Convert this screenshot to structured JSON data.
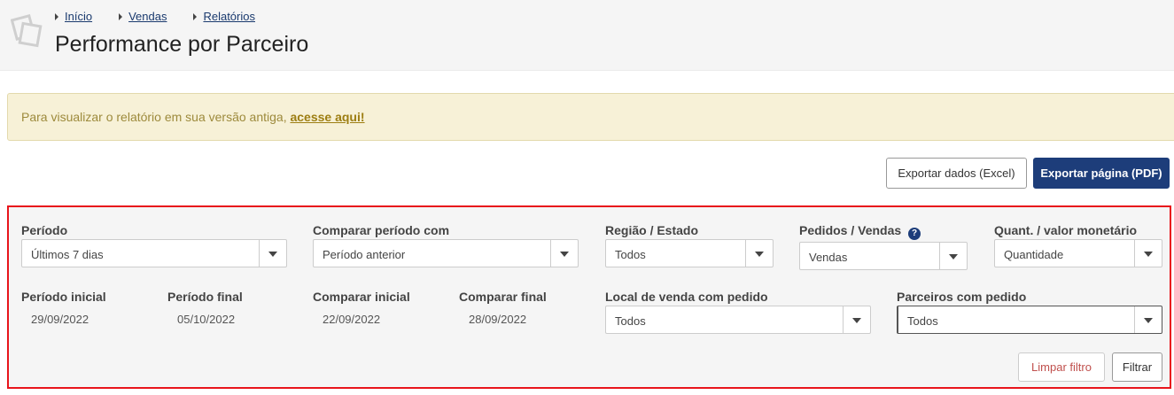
{
  "header": {
    "breadcrumb": [
      {
        "label": "Início"
      },
      {
        "label": "Vendas"
      },
      {
        "label": "Relatórios"
      }
    ],
    "title": "Performance por Parceiro"
  },
  "notice": {
    "text": "Para visualizar o relatório em sua versão antiga,",
    "link": "acesse aqui!"
  },
  "actions": {
    "export_excel": "Exportar dados (Excel)",
    "export_pdf": "Exportar página (PDF)"
  },
  "filters": {
    "periodo": {
      "label": "Período",
      "value": "Últimos 7 dias"
    },
    "comparar": {
      "label": "Comparar período com",
      "value": "Período anterior"
    },
    "regiao": {
      "label": "Região / Estado",
      "value": "Todos"
    },
    "pedidos": {
      "label": "Pedidos / Vendas",
      "value": "Vendas",
      "help": "?"
    },
    "quant": {
      "label": "Quant. / valor monetário",
      "value": "Quantidade"
    },
    "periodo_inicial": {
      "label": "Período inicial",
      "value": "29/09/2022"
    },
    "periodo_final": {
      "label": "Período final",
      "value": "05/10/2022"
    },
    "comparar_inicial": {
      "label": "Comparar inicial",
      "value": "22/09/2022"
    },
    "comparar_final": {
      "label": "Comparar final",
      "value": "28/09/2022"
    },
    "local_venda": {
      "label": "Local de venda com pedido",
      "value": "Todos"
    },
    "parceiros": {
      "label": "Parceiros com pedido",
      "value": "Todos"
    },
    "clear_button": "Limpar filtro",
    "filter_button": "Filtrar"
  },
  "colors": {
    "primary": "#1d3d7a",
    "highlight_border": "#e8141b",
    "notice_bg": "#f7f1d7",
    "notice_link": "#9d7e12"
  }
}
